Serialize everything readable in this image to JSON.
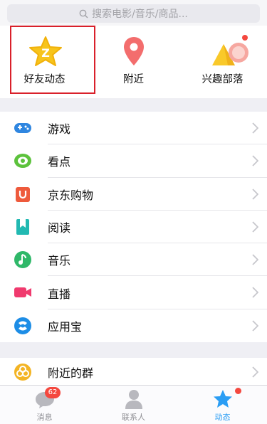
{
  "search": {
    "placeholder": "搜索电影/音乐/商品..."
  },
  "quick_actions": [
    {
      "label": "好友动态",
      "icon": "friend-feed-star-icon"
    },
    {
      "label": "附近",
      "icon": "location-pin-icon"
    },
    {
      "label": "兴趣部落",
      "icon": "interest-tribe-icon"
    }
  ],
  "list": [
    {
      "label": "游戏",
      "icon": "gamepad-icon",
      "color": "#2f86e0"
    },
    {
      "label": "看点",
      "icon": "eye-icon",
      "color": "#5cc23c"
    },
    {
      "label": "京东购物",
      "icon": "jd-bag-icon",
      "color": "#ee5a3c"
    },
    {
      "label": "阅读",
      "icon": "bookmark-icon",
      "color": "#22b9b2"
    },
    {
      "label": "音乐",
      "icon": "music-note-icon",
      "color": "#2fb869"
    },
    {
      "label": "直播",
      "icon": "video-camera-icon",
      "color": "#f03a6e"
    },
    {
      "label": "应用宝",
      "icon": "app-store-icon",
      "color": "#1d8de6"
    }
  ],
  "list2": [
    {
      "label": "附近的群",
      "icon": "nearby-group-icon",
      "color": "#f3b424"
    }
  ],
  "tabs": [
    {
      "label": "消息",
      "badge": "62"
    },
    {
      "label": "联系人"
    },
    {
      "label": "动态",
      "active": true
    }
  ],
  "colors": {
    "accent": "#2a9df4",
    "badge": "#f4483f",
    "highlight": "#d9202a"
  }
}
